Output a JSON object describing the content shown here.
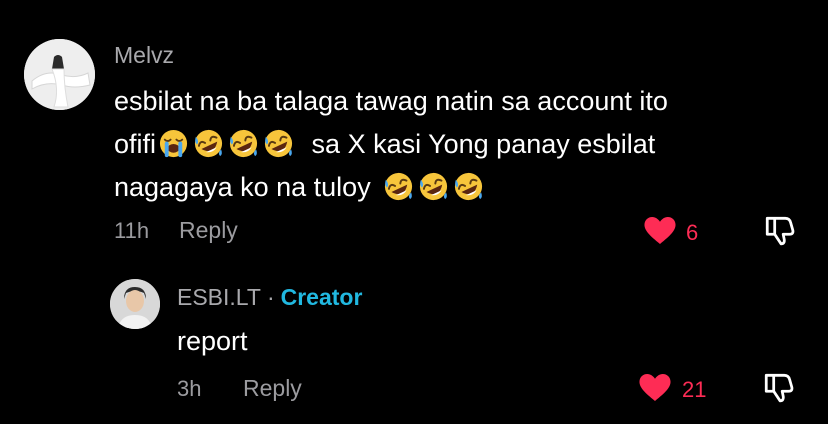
{
  "comment": {
    "username": "Melvz",
    "line1": "esbilat na ba talaga tawag natin sa account ito",
    "line2_prefix": "ofifi",
    "line2_suffix": "sa X kasi Yong panay esbilat",
    "line3": "nagagaya ko na tuloy",
    "emoji_names": [
      "loudly-crying-face",
      "rolling-on-floor-laughing"
    ],
    "time": "11h",
    "reply_label": "Reply",
    "likes": "6",
    "liked": true
  },
  "reply": {
    "username": "ESBI.LT",
    "separator": "·",
    "badge": "Creator",
    "text": "report",
    "time": "3h",
    "reply_label": "Reply",
    "likes": "21",
    "liked": true
  },
  "colors": {
    "background": "#000000",
    "like": "#fe2c55",
    "creator": "#21b8e0",
    "muted": "#9b9b9f"
  }
}
